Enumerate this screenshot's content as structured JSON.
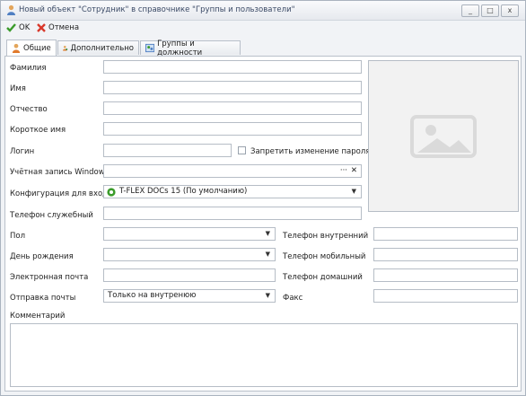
{
  "window": {
    "title": "Новый объект \"Сотрудник\" в справочнике \"Группы и пользователи\"",
    "btn_minimize": "_",
    "btn_maximize": "□",
    "btn_close": "x"
  },
  "toolbar": {
    "ok_label": "OK",
    "cancel_label": "Отмена"
  },
  "tabs": [
    {
      "label": "Общие"
    },
    {
      "label": "Дополнительно"
    },
    {
      "label": "Группы и должности"
    }
  ],
  "form": {
    "last_name_label": "Фамилия",
    "last_name_value": "",
    "first_name_label": "Имя",
    "first_name_value": "",
    "middle_name_label": "Отчество",
    "middle_name_value": "",
    "short_name_label": "Короткое имя",
    "short_name_value": "",
    "login_label": "Логин",
    "login_value": "",
    "forbid_password_label": "Запретить изменение пароля",
    "windows_account_label": "Учётная запись Windows",
    "windows_account_value": "",
    "windows_account_browse": "···",
    "windows_account_clear": "✕",
    "config_label": "Конфигурация для входа",
    "config_value": "T-FLEX DOCs 15 (По умолчанию)",
    "work_phone_label": "Телефон служебный",
    "gender_label": "Пол",
    "birthday_label": "День рождения",
    "email_label": "Электронная почта",
    "mail_send_label": "Отправка почты",
    "mail_send_value": "Только на внутренюю",
    "internal_phone_label": "Телефон внутренний",
    "mobile_phone_label": "Телефон мобильный",
    "home_phone_label": "Телефон домашний",
    "fax_label": "Факс",
    "comment_label": "Комментарий"
  },
  "colors": {
    "accent_green": "#3a9b2a",
    "cancel_red": "#d8382b",
    "title_text": "#3b4a66"
  }
}
